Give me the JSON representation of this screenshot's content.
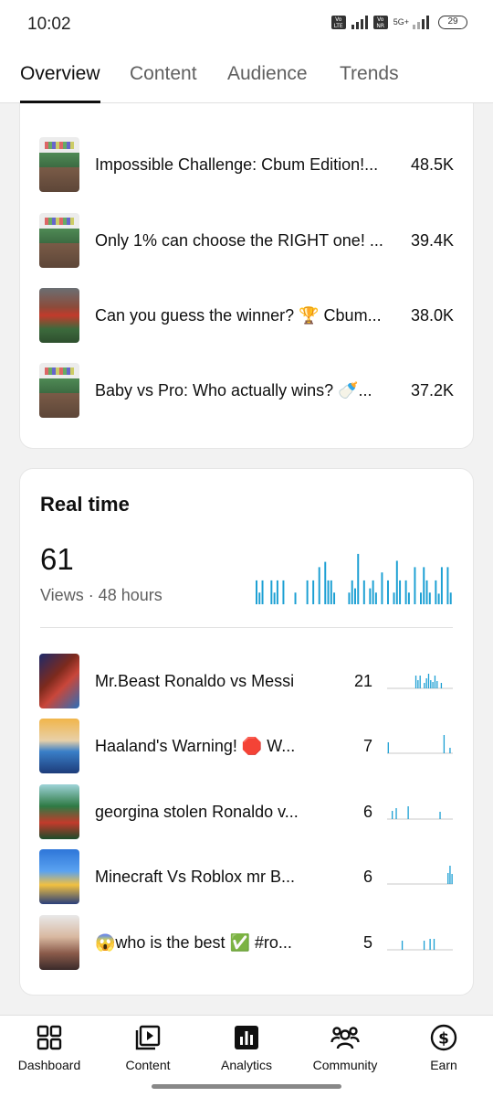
{
  "status_bar": {
    "time": "10:02",
    "battery": "29",
    "network": "5G+"
  },
  "tabs": [
    {
      "label": "Overview",
      "active": true
    },
    {
      "label": "Content",
      "active": false
    },
    {
      "label": "Audience",
      "active": false
    },
    {
      "label": "Trends",
      "active": false
    }
  ],
  "top_content": [
    {
      "title": "Impossible Challenge: Cbum Edition!...",
      "value": "48.5K"
    },
    {
      "title": "Only 1% can choose the RIGHT one! ...",
      "value": "39.4K"
    },
    {
      "title": "Can you guess the winner? 🏆 Cbum...",
      "value": "38.0K"
    },
    {
      "title": "Baby vs Pro: Who actually wins? 🍼...",
      "value": "37.2K"
    }
  ],
  "realtime": {
    "title": "Real time",
    "views": "61",
    "subtitle": "Views · 48 hours",
    "bars": [
      0.45,
      0.22,
      0.45,
      0,
      0,
      0.45,
      0.22,
      0.45,
      0,
      0.45,
      0,
      0,
      0,
      0.22,
      0,
      0,
      0,
      0.45,
      0,
      0.45,
      0,
      0.7,
      0,
      0.8,
      0.45,
      0.45,
      0.22,
      0,
      0,
      0,
      0,
      0.22,
      0.45,
      0.3,
      0.95,
      0,
      0.45,
      0,
      0.3,
      0.45,
      0.22,
      0,
      0.6,
      0,
      0.45,
      0,
      0.22,
      0.82,
      0.45,
      0,
      0.45,
      0.22,
      0,
      0.7,
      0,
      0.22,
      0.7,
      0.45,
      0.22,
      0,
      0.45,
      0.2,
      0.7,
      0,
      0.7,
      0.22
    ],
    "color": "#1b9fd3",
    "items": [
      {
        "title": "Mr.Beast Ronaldo vs Messi",
        "value": "21",
        "spark": [
          0,
          0,
          0,
          0,
          0,
          0,
          0,
          0,
          0,
          0,
          0,
          0,
          0,
          0.7,
          0.45,
          0.7,
          0,
          0.3,
          0.55,
          0.8,
          0.45,
          0.35,
          0.7,
          0.4,
          0,
          0.3,
          0,
          0,
          0,
          0,
          0
        ]
      },
      {
        "title": "Haaland's Warning! 🛑 W...",
        "value": "7",
        "spark": [
          0.6,
          0,
          0,
          0,
          0,
          0,
          0,
          0,
          0,
          0,
          0,
          0,
          0,
          0,
          0,
          0,
          0,
          0,
          0,
          0,
          0,
          0,
          0,
          0,
          0,
          0,
          0,
          0,
          1,
          0,
          0,
          0.3,
          0
        ]
      },
      {
        "title": "georgina stolen Ronaldo v...",
        "value": "6",
        "spark": [
          0,
          0,
          0.45,
          0,
          0.6,
          0,
          0,
          0,
          0,
          0,
          0.7,
          0,
          0,
          0,
          0,
          0,
          0,
          0,
          0,
          0,
          0,
          0,
          0,
          0,
          0,
          0,
          0.4,
          0,
          0,
          0,
          0,
          0,
          0
        ]
      },
      {
        "title": "Minecraft Vs Roblox mr B...",
        "value": "6",
        "spark": [
          0,
          0,
          0,
          0,
          0,
          0,
          0,
          0,
          0,
          0,
          0,
          0,
          0,
          0,
          0,
          0,
          0,
          0,
          0,
          0,
          0,
          0,
          0,
          0,
          0,
          0,
          0,
          0,
          0,
          0,
          0.6,
          1,
          0.55
        ]
      },
      {
        "title": "😱who is the best ✅ #ro...",
        "value": "5",
        "spark": [
          0,
          0,
          0,
          0,
          0,
          0,
          0,
          0.5,
          0,
          0,
          0,
          0,
          0,
          0,
          0,
          0,
          0,
          0,
          0.5,
          0,
          0,
          0.6,
          0,
          0.6,
          0,
          0,
          0,
          0,
          0,
          0,
          0,
          0,
          0
        ]
      }
    ]
  },
  "bottom_nav": [
    {
      "label": "Dashboard",
      "icon": "dashboard-icon"
    },
    {
      "label": "Content",
      "icon": "content-icon"
    },
    {
      "label": "Analytics",
      "icon": "analytics-icon"
    },
    {
      "label": "Community",
      "icon": "community-icon"
    },
    {
      "label": "Earn",
      "icon": "earn-icon"
    }
  ]
}
